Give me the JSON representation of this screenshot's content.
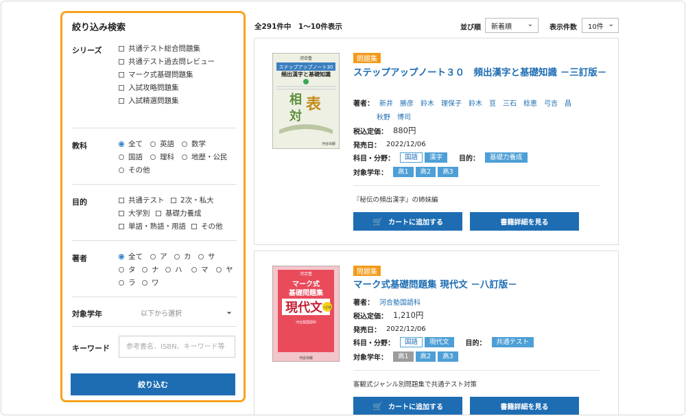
{
  "sidebar": {
    "title": "絞り込み検索",
    "series": {
      "label": "シリーズ",
      "options": [
        "共通テスト総合問題集",
        "共通テスト過去問レビュー",
        "マーク式基礎問題集",
        "入試攻略問題集",
        "入試精選問題集"
      ]
    },
    "subject": {
      "label": "教科",
      "options": [
        "全て",
        "英語",
        "数学",
        "国語",
        "理科",
        "地歴・公民",
        "その他"
      ],
      "selected": "全て"
    },
    "purpose": {
      "label": "目的",
      "options": [
        "共通テスト",
        "2次・私大",
        "大学別",
        "基礎力養成",
        "単語・熟語・用語",
        "その他"
      ]
    },
    "author": {
      "label": "著者",
      "options": [
        "全て",
        "ア",
        "カ",
        "サ",
        "タ",
        "ナ",
        "ハ",
        "マ",
        "ヤ",
        "ラ",
        "ワ"
      ],
      "selected": "全て"
    },
    "grade": {
      "label": "対象学年",
      "placeholder": "以下から選択"
    },
    "keyword": {
      "label": "キーワード",
      "placeholder": "参考書名、ISBN、キーワード等"
    },
    "submit_label": "絞り込む"
  },
  "results": {
    "count_text": "全291件中　1〜10件表示",
    "sort_label": "並び順",
    "sort_value": "新着順",
    "per_page_label": "表示件数",
    "per_page_value": "10件"
  },
  "products": [
    {
      "badge": "問題集",
      "title": "ステップアップノート３０　頻出漢字と基礎知識 －三訂版－",
      "authors_label": "著者：",
      "authors": [
        "新井　勝彦",
        "鈴木　理保子",
        "鈴木　亘",
        "三石　稔恵",
        "弓吉　昌",
        "秋野　博司"
      ],
      "price_label": "税込定価：",
      "price": "880円",
      "release_label": "発売日：",
      "release": "2022/12/06",
      "field_label": "科目・分野：",
      "fields": [
        "国語",
        "漢字"
      ],
      "purpose_label": "目的：",
      "purposes": [
        "基礎力養成"
      ],
      "grade_label": "対象学年：",
      "grades": [
        "高1",
        "高2",
        "高3"
      ],
      "description": "『秘伝の頻出漢字』の姉妹編",
      "cart_label": "カートに追加する",
      "detail_label": "書籍詳細を見る",
      "cover": {
        "publisher": "河合塾",
        "series": "ステップアップノート30",
        "title": "頻出漢字と基礎知識",
        "big1": "表",
        "big2": "相",
        "big3": "対",
        "edition": "三訂版"
      }
    },
    {
      "badge": "問題集",
      "title": "マーク式基礎問題集 現代文 －八訂版－",
      "authors_label": "著者：",
      "authors": [
        "河合塾国語科"
      ],
      "price_label": "税込定価：",
      "price": "1,210円",
      "release_label": "発売日：",
      "release": "2022/12/06",
      "field_label": "科目・分野：",
      "fields": [
        "国語",
        "現代文"
      ],
      "purpose_label": "目的：",
      "purposes": [
        "共通テスト"
      ],
      "grade_label": "対象学年：",
      "grades": [
        "高1",
        "高2",
        "高3"
      ],
      "description": "客観式ジャンル別問題集で共通テスト対策",
      "cart_label": "カートに追加する",
      "detail_label": "書籍詳細を見る",
      "cover": {
        "publisher": "河合塾",
        "series": "マーク式",
        "title": "基礎問題集",
        "big1": "現代文",
        "edition": "八訂版"
      }
    }
  ],
  "colors": {
    "accent": "#1e6db3",
    "highlight_border": "#f7a21b",
    "badge": "#f39a1a",
    "tag": "#4d9fd6"
  }
}
